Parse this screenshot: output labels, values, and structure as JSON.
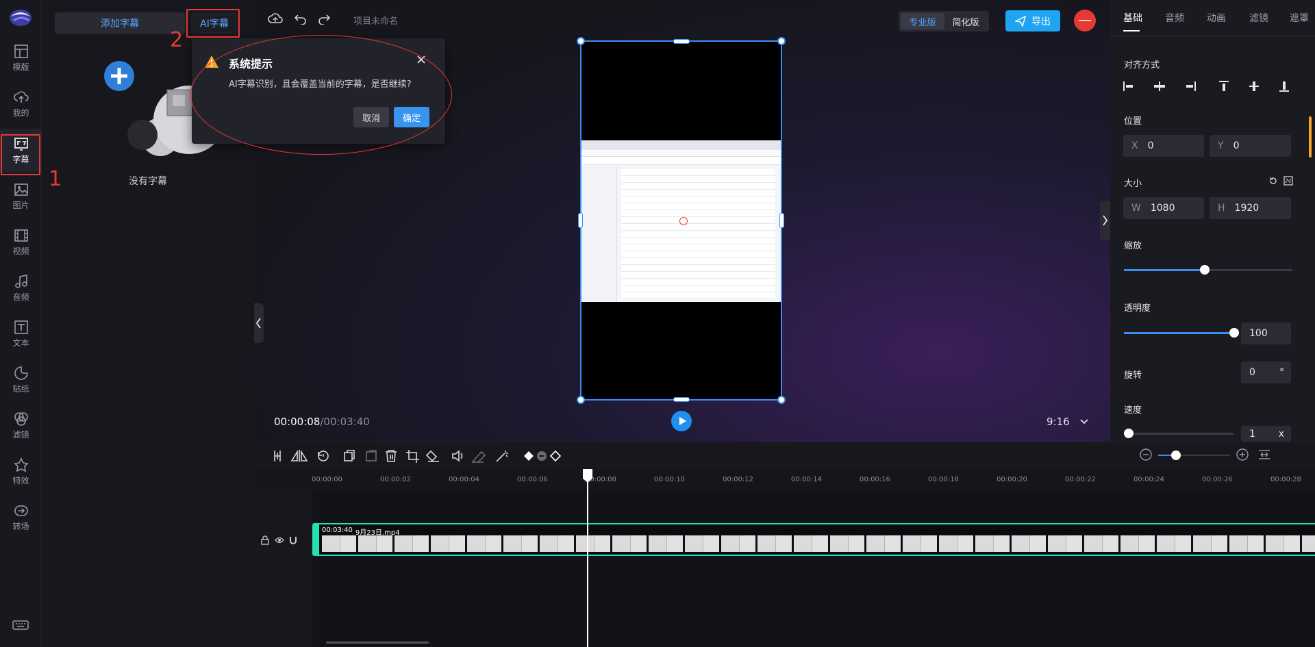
{
  "nav": {
    "items": [
      {
        "label": "模版",
        "icon": "template-icon"
      },
      {
        "label": "我的",
        "icon": "cloud-upload-icon"
      },
      {
        "label": "字幕",
        "icon": "subtitle-icon"
      },
      {
        "label": "图片",
        "icon": "image-icon"
      },
      {
        "label": "视频",
        "icon": "video-icon"
      },
      {
        "label": "音频",
        "icon": "music-icon"
      },
      {
        "label": "文本",
        "icon": "text-icon"
      },
      {
        "label": "贴纸",
        "icon": "sticker-icon"
      },
      {
        "label": "滤镜",
        "icon": "filter-icon"
      },
      {
        "label": "特效",
        "icon": "effects-icon"
      },
      {
        "label": "转场",
        "icon": "transition-icon"
      }
    ]
  },
  "annotations": {
    "step1": "1",
    "step2": "2"
  },
  "subtitle_panel": {
    "add_subtitle": "添加字幕",
    "ai_subtitle": "AI字幕",
    "empty_text": "没有字幕"
  },
  "dialog": {
    "title": "系统提示",
    "message": "AI字幕识别，且会覆盖当前的字幕，是否继续?",
    "cancel": "取消",
    "confirm": "确定"
  },
  "topbar": {
    "project_name": "项目未命名",
    "pro_mode": "专业版",
    "simple_mode": "简化版",
    "export": "导出"
  },
  "preview": {
    "current_time": "00:00:08",
    "total_time": "/00:03:40",
    "aspect_ratio": "9:16"
  },
  "right_panel": {
    "tabs": [
      "基础",
      "音频",
      "动画",
      "滤镜",
      "遮罩"
    ],
    "align_label": "对齐方式",
    "position_label": "位置",
    "x_key": "X",
    "x_val": "0",
    "y_key": "Y",
    "y_val": "0",
    "size_label": "大小",
    "w_key": "W",
    "w_val": "1080",
    "h_key": "H",
    "h_val": "1920",
    "scale_label": "缩放",
    "scale_level": 0.48,
    "opacity_label": "透明度",
    "opacity_val": "100",
    "rotate_label": "旋转",
    "rotate_val": "0",
    "rotate_unit": "°",
    "speed_label": "速度",
    "speed_val": "1",
    "speed_unit": "x"
  },
  "timeline": {
    "ticks": [
      "00:00:00",
      "00:00:02",
      "00:00:04",
      "00:00:06",
      "00:00:08",
      "00:00:10",
      "00:00:12",
      "00:00:14",
      "00:00:16",
      "00:00:18",
      "00:00:20",
      "00:00:22",
      "00:00:24",
      "00:00:26",
      "00:00:28"
    ],
    "clip_duration": "00:03:40",
    "clip_name": "9月23日.mp4"
  },
  "colors": {
    "accent": "#2f9bff",
    "clip_border": "#22e0b0",
    "annotation": "#e53935"
  }
}
